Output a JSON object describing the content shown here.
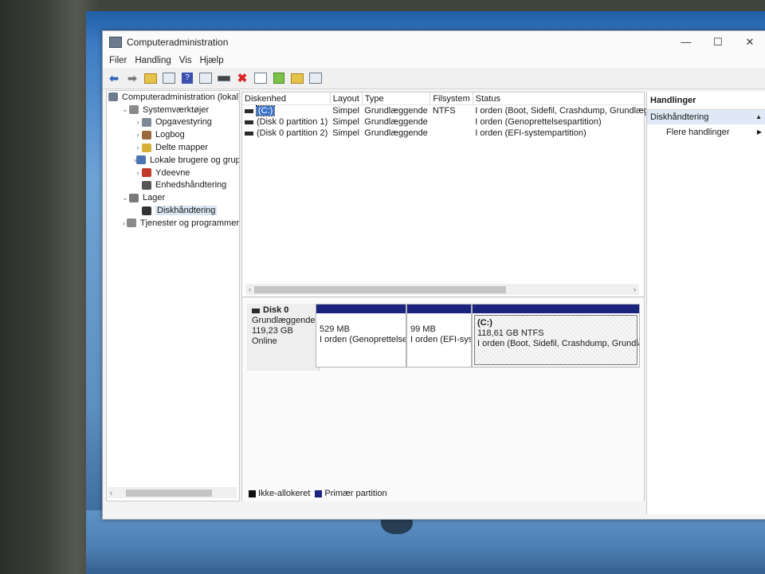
{
  "window": {
    "title": "Computeradministration",
    "controls": [
      "—",
      "☐",
      "✕"
    ]
  },
  "menu": [
    "Filer",
    "Handling",
    "Vis",
    "Hjælp"
  ],
  "tree": [
    {
      "label": "Computeradministration (lokal)",
      "level": 0,
      "arrow": "",
      "icon": "computer-icon",
      "color": "#6d7d8f"
    },
    {
      "label": "Systemværktøjer",
      "level": 1,
      "arrow": "⌄",
      "icon": "tools-icon",
      "color": "#8a8a8a"
    },
    {
      "label": "Opgavestyring",
      "level": 2,
      "arrow": "›",
      "icon": "clock-icon",
      "color": "#7d8a96"
    },
    {
      "label": "Logbog",
      "level": 2,
      "arrow": "›",
      "icon": "log-icon",
      "color": "#9c6a3a"
    },
    {
      "label": "Delte mapper",
      "level": 2,
      "arrow": "›",
      "icon": "shared-folder-icon",
      "color": "#d6b13a"
    },
    {
      "label": "Lokale brugere og grupp",
      "level": 2,
      "arrow": "›",
      "icon": "users-icon",
      "color": "#4d74b3"
    },
    {
      "label": "Ydeevne",
      "level": 2,
      "arrow": "›",
      "icon": "performance-icon",
      "color": "#c03a2b"
    },
    {
      "label": "Enhedshåndtering",
      "level": 2,
      "arrow": "",
      "icon": "device-icon",
      "color": "#555"
    },
    {
      "label": "Lager",
      "level": 1,
      "arrow": "⌄",
      "icon": "storage-icon",
      "color": "#7a7a7a"
    },
    {
      "label": "Diskhåndtering",
      "level": 2,
      "arrow": "",
      "icon": "disk-icon",
      "color": "#333",
      "selected": true
    },
    {
      "label": "Tjenester og programmer",
      "level": 1,
      "arrow": "›",
      "icon": "services-icon",
      "color": "#8a8a8a"
    }
  ],
  "volumes": {
    "columns": [
      "Diskenhed",
      "Layout",
      "Type",
      "Filsystem",
      "Status"
    ],
    "rows": [
      [
        "(C:)",
        "Simpel",
        "Grundlæggende",
        "NTFS",
        "I orden (Boot, Sidefil, Crashdump, Grundlæggen"
      ],
      [
        "(Disk 0 partition 1)",
        "Simpel",
        "Grundlæggende",
        "",
        "I orden (Genoprettelsespartition)"
      ],
      [
        "(Disk 0 partition 2)",
        "Simpel",
        "Grundlæggende",
        "",
        "I orden (EFI-systempartition)"
      ]
    ]
  },
  "disk": {
    "name": "Disk 0",
    "type": "Grundlæggende",
    "size": "119,23 GB",
    "state": "Online",
    "partitions": [
      {
        "title": "",
        "size": "529 MB",
        "status": "I orden (Genoprettelse"
      },
      {
        "title": "",
        "size": "99 MB",
        "status": "I orden (EFI-syst"
      },
      {
        "title": "(C:)",
        "size": "118,61 GB NTFS",
        "status": "I orden (Boot, Sidefil, Crashdump, Grundlægg"
      }
    ]
  },
  "legend": [
    {
      "label": "Ikke-allokeret",
      "color": "#111111"
    },
    {
      "label": "Primær partition",
      "color": "#1a237e"
    }
  ],
  "actions": {
    "header": "Handlinger",
    "section": "Diskhåndtering",
    "more": "Flere handlinger"
  },
  "colors": {
    "partition_bar": "#1a237e",
    "selection": "#3b74c9"
  }
}
